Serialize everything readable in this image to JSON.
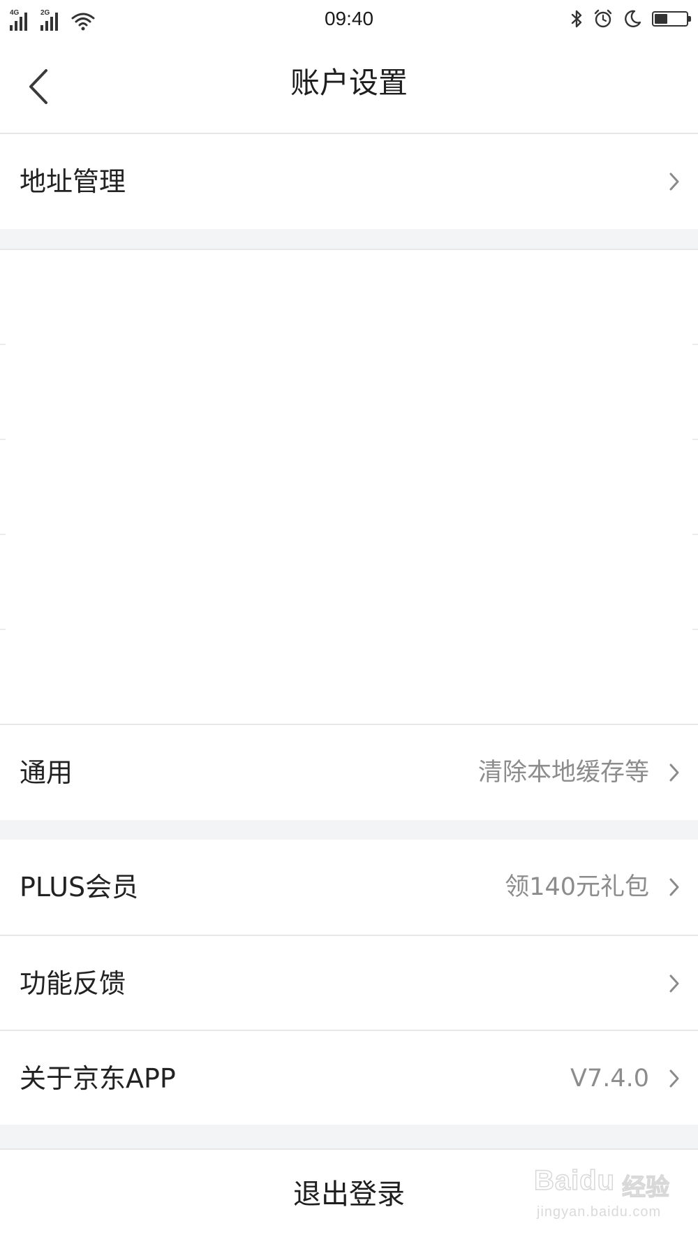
{
  "status_bar": {
    "time": "09:40",
    "network_1": "4G",
    "network_2": "2G",
    "icons": [
      "signal-icon",
      "signal-icon",
      "wifi-icon",
      "bluetooth-icon",
      "alarm-icon",
      "moon-icon",
      "battery-icon"
    ],
    "battery_level_percent": 40
  },
  "header": {
    "title": "账户设置",
    "back_icon": "chevron-left-icon"
  },
  "rows": {
    "address": {
      "label": "地址管理",
      "value": ""
    },
    "general": {
      "label": "通用",
      "value": "清除本地缓存等"
    },
    "plus": {
      "label": "PLUS会员",
      "value": "领140元礼包"
    },
    "feedback": {
      "label": "功能反馈",
      "value": ""
    },
    "about": {
      "label": "关于京东APP",
      "value": "V7.4.0"
    }
  },
  "logout": {
    "label": "退出登录"
  },
  "watermark": {
    "brand": "Bai",
    "brand_tail": "du",
    "cn": "经验",
    "url": "jingyan.baidu.com"
  },
  "colors": {
    "page_bg": "#ffffff",
    "gap_bg": "#f3f4f6",
    "divider": "#e8e8e8",
    "label_text": "#222222",
    "value_text": "#8c8c8c"
  }
}
